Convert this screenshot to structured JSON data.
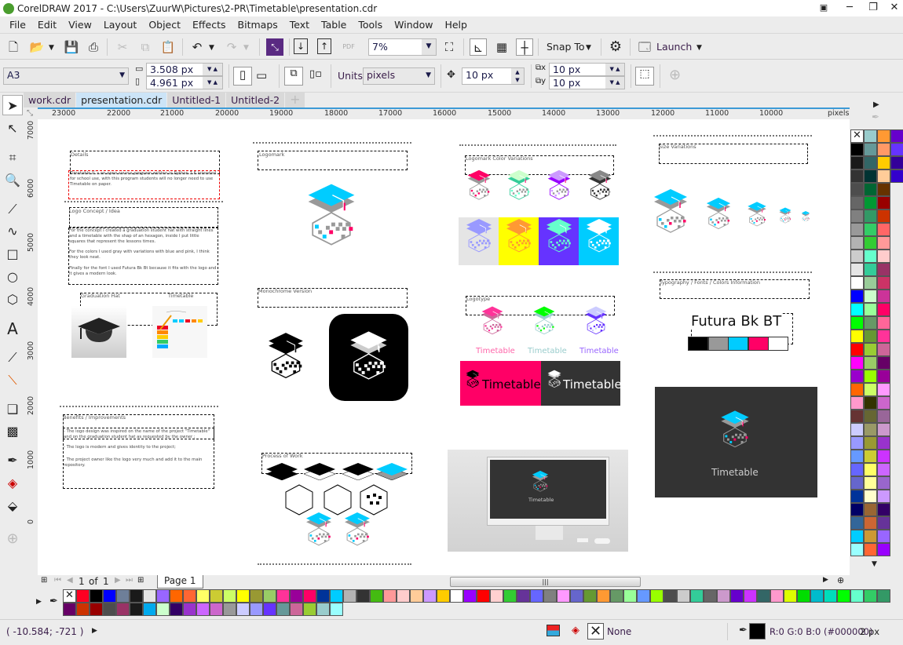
{
  "window": {
    "title": "CorelDRAW 2017 - C:\\Users\\ZuurW\\Pictures\\2-PR\\Timetable\\presentation.cdr"
  },
  "menu": [
    "File",
    "Edit",
    "View",
    "Layout",
    "Object",
    "Effects",
    "Bitmaps",
    "Text",
    "Table",
    "Tools",
    "Window",
    "Help"
  ],
  "toolbar": {
    "zoom": "7%",
    "snap_to": "Snap To",
    "launch": "Launch",
    "pdf": "PDF"
  },
  "propbar": {
    "page_size": "A3",
    "width": "3.508 px",
    "height": "4.961 px",
    "units_label": "Units:",
    "units": "pixels",
    "nudge": "10 px",
    "dup_x": "10 px",
    "dup_y": "10 px"
  },
  "doc_tabs": [
    {
      "label": "work.cdr",
      "active": false
    },
    {
      "label": "presentation.cdr",
      "active": true
    },
    {
      "label": "Untitled-1",
      "active": false
    },
    {
      "label": "Untitled-2",
      "active": false
    }
  ],
  "hruler": {
    "labels": [
      "23000",
      "22000",
      "21000",
      "20000",
      "19000",
      "18000",
      "17000",
      "16000",
      "15000",
      "14000",
      "13000",
      "12000",
      "11000",
      "10000"
    ],
    "unit": "pixels"
  },
  "vruler": {
    "labels": [
      "7000",
      "6000",
      "5000",
      "4000",
      "3000",
      "2000",
      "1000",
      "0"
    ]
  },
  "canvas": {
    "details": {
      "heading": "Details",
      "body": "Timetable It`s an open source program written in Python 3.6 intended for school use, with this program students will no longer need to use Timetable on paper."
    },
    "concept": {
      "heading": "Logo Concept / Idea",
      "paragraphs": [
        "For the concept I created a graduation student hat with straight lines and a timetable with the shap of an hexagon, inside I put little squares that represent the lessons times.",
        "For the colors I used gray with variations with blue and pink, I think they look neat.",
        "Finally for the font I used Futura Bk Bt because it fits with the logo and it gives a modern look."
      ]
    },
    "references": {
      "hat_label": "Graduation Hat",
      "timetable_label": "Timetable"
    },
    "benefits": {
      "heading": "Benefits / Improvements",
      "paragraphs": [
        "- The logo design was inspired on the name of the project \"Timetable\" and on the graduation student hat as requested by the owner ;",
        "- The logo is modern and gives identity to the project;",
        "- The project owner like the logo very much and add it to the main repository."
      ]
    },
    "logomark": {
      "heading": "Logomark"
    },
    "monochrome": {
      "heading": "Monochrome Version"
    },
    "process": {
      "heading": "Process of Work"
    },
    "color_variations": {
      "heading": "Logomark Color Variations"
    },
    "logotype": {
      "heading": "Logotype",
      "wordmarks": [
        "Timetable",
        "Timetable",
        "Timetable"
      ],
      "banners": [
        "Timetable",
        "Timetable"
      ]
    },
    "size_variations": {
      "heading": "Size Variations"
    },
    "typography": {
      "heading": "Typography / Fonts / Colors Information",
      "font_sample": "Futura Bk BT",
      "swatches": [
        "#000000",
        "#999999",
        "#00ccff",
        "#ff0066",
        "#ffffff"
      ]
    },
    "mockup": {
      "label": "Timetable"
    },
    "dark_panel": {
      "label": "Timetable"
    }
  },
  "logo_colors": {
    "cap": "#00ccff",
    "under": "#999999",
    "tassel": "#ff0066",
    "hex": "#999999"
  },
  "pagenav": {
    "current": "1",
    "of": "of",
    "total": "1",
    "page_tab": "Page 1"
  },
  "status": {
    "coords": "( -10.584; -721  )",
    "fill": "None",
    "outline_color": "R:0 G:0 B:0 (#000000)",
    "outline_width": "2 px"
  },
  "palette_right": [
    [
      "x",
      "#000000",
      "#1a1a1a",
      "#333333",
      "#4d4d4d",
      "#666666",
      "#808080",
      "#999999",
      "#b3b3b3",
      "#cccccc",
      "#e5e5e5",
      "#ffffff",
      "#0000ff",
      "#00ffff",
      "#00ff00",
      "#ffff00",
      "#ff0000",
      "#ff00ff",
      "#9900cc",
      "#ff6600",
      "#ff99cc",
      "#663333",
      "#ccccff",
      "#9999ff",
      "#6699ff",
      "#6666ff",
      "#6666cc",
      "#003399",
      "#000066",
      "#336699",
      "#00ccff",
      "#99ffff"
    ],
    [
      "#99cccc",
      "#669999",
      "#336666",
      "#003333",
      "#006633",
      "#009933",
      "#339966",
      "#33cc66",
      "#33cc33",
      "#66ffcc",
      "#33cc99",
      "#99cc99",
      "#ccffcc",
      "#99ff99",
      "#669966",
      "#669933",
      "#99cc33",
      "#99cc66",
      "#99ff00",
      "#ccff66",
      "#333300",
      "#666633",
      "#999966",
      "#999933",
      "#cccc33",
      "#ffff66",
      "#ffff99",
      "#ffffcc",
      "#996633",
      "#cc6633",
      "#cc9933",
      "#ff6633"
    ],
    [
      "#ff9933",
      "#ff9966",
      "#ffcc00",
      "#ffcc99",
      "#663300",
      "#990000",
      "#cc3300",
      "#ff6666",
      "#ff9999",
      "#ffcccc",
      "#993366",
      "#cc3366",
      "#cc3399",
      "#ff0066",
      "#ff6699",
      "#ff3399",
      "#cc6699",
      "#660066",
      "#990099",
      "#ff99ff",
      "#cc66cc",
      "#996699",
      "#cc99cc",
      "#9933cc",
      "#cc33ff",
      "#cc66ff",
      "#9966cc",
      "#cc99ff",
      "#330066",
      "#663399",
      "#9966ff",
      "#9900ff"
    ],
    [
      "#6600cc",
      "#6633ff",
      "#330099",
      "#3300cc"
    ]
  ],
  "palette_bottom": [
    [
      "x",
      "#ff0022",
      "#000000",
      "#0000ff",
      "#6e7f99",
      "#1a1a1a",
      "#e5e5e5",
      "#9966ff",
      "#ff6600",
      "#ff6633",
      "#ffff66",
      "#cccc33",
      "#ccff66",
      "#ffff00",
      "#999933",
      "#99cc66",
      "#ff3399",
      "#990099",
      "#ff0066",
      "#003399",
      "#00ccff",
      "#b3b3b3",
      "#333333",
      "#44bb11",
      "#ff9999",
      "#ffcccc",
      "#ffcc99",
      "#cc99ff",
      "#ffcc00",
      "#ffffff",
      "#9900ff",
      "#ff0000",
      "#ffd0d0",
      "#33cc33",
      "#663399",
      "#6666ff",
      "#808080",
      "#ff99ff",
      "#6666cc",
      "#669933",
      "#ff9933",
      "#669966",
      "#99ff99",
      "#6699ff",
      "#99ff00",
      "#4d4d4d",
      "#cccccc",
      "#33cc99",
      "#666666",
      "#cc99cc",
      "#6600cc",
      "#cc33ff",
      "#336666",
      "#ff99cc",
      "#ddff00",
      "#00dd00",
      "#00bbcc",
      "#00ddbb",
      "#00ff00",
      "#66ffcc",
      "#33cc66",
      "#339966"
    ],
    [
      "#660066",
      "#cc3300",
      "#990000",
      "#4d4d4d",
      "#993366",
      "#1a1a1a",
      "#00aaee",
      "#ccffcc",
      "#330066",
      "#9933cc",
      "#cc66ff",
      "#cc66cc",
      "#999999",
      "#ccccff",
      "#9999ff",
      "#6633ff",
      "#669999",
      "#cc6699",
      "#99cc33",
      "#99cccc",
      "#99ffff"
    ]
  ]
}
